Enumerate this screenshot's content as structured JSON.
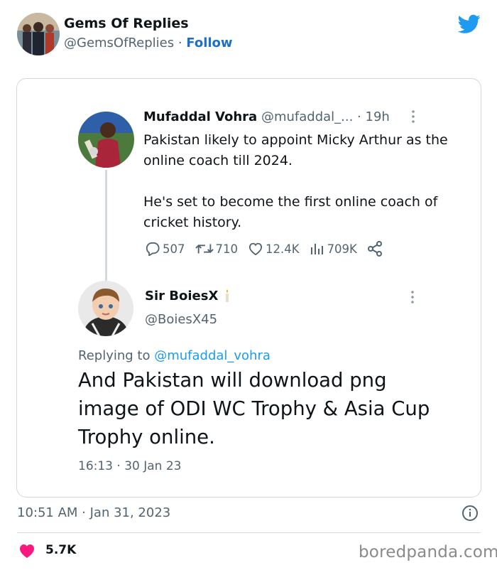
{
  "embed": {
    "account_name": "Gems Of Replies",
    "account_handle": "@GemsOfReplies",
    "separator": " · ",
    "follow_label": "Follow",
    "timestamp": "10:51 AM · Jan 31, 2023",
    "like_count": "5.7K"
  },
  "quoted_tweet": {
    "name": "Mufaddal Vohra",
    "handle": "@mufaddal_...",
    "time": "· 19h",
    "text": "Pakistan likely to appoint Micky Arthur as the online coach till 2024.\n\nHe's set to become the first online coach of cricket history.",
    "stats": {
      "replies": "507",
      "retweets": "710",
      "likes": "12.4K",
      "views": "709K"
    }
  },
  "reply_tweet": {
    "name": "Sir BoiesX",
    "handle": "@BoiesX45",
    "replying_prefix": "Replying to ",
    "replying_mention": "@mufaddal_vohra",
    "text": "And Pakistan will download png image of ODI WC Trophy & Asia Cup Trophy online.",
    "timestamp": "16:13 · 30 Jan 23"
  },
  "watermark": "boredpanda.com",
  "colors": {
    "link_blue": "#1d70c2",
    "mention_blue": "#1d9bf0",
    "twitter_blue": "#1d9bf0",
    "heart_pink": "#f91880",
    "muted_text": "#536471"
  },
  "icons": [
    "twitter-bird-icon",
    "reply-icon",
    "retweet-icon",
    "like-icon",
    "views-icon",
    "share-icon",
    "more-icon",
    "candle-icon",
    "info-icon",
    "heart-icon"
  ]
}
